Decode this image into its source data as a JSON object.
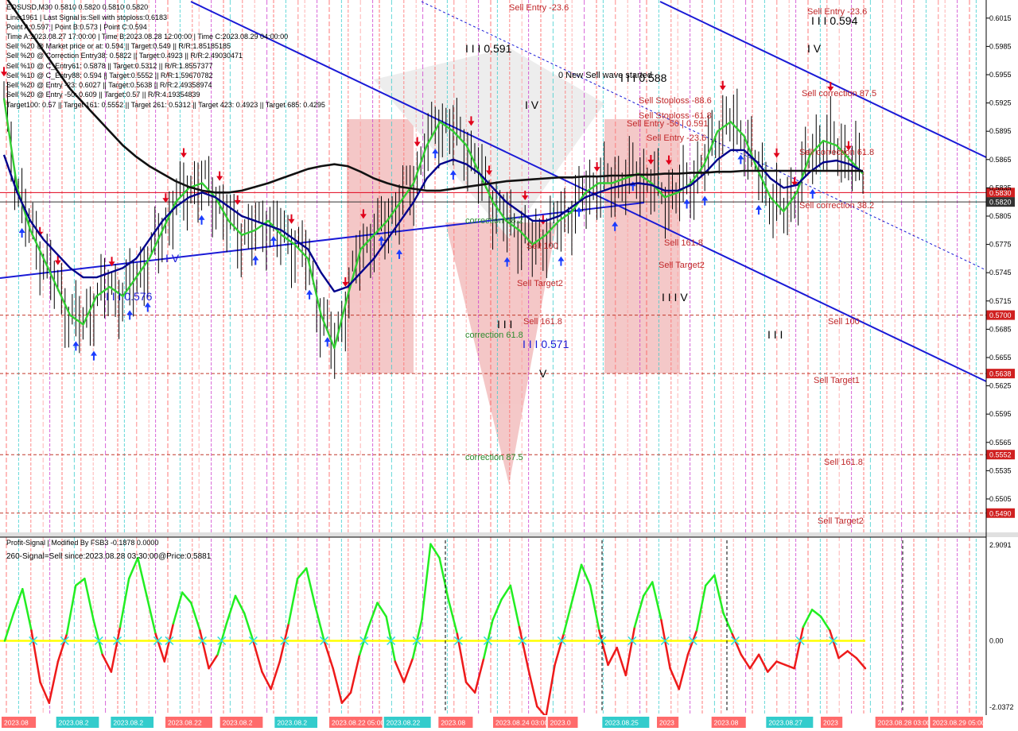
{
  "window": {
    "symbol_line": "EOSUSD,M30  0.5810 0.5820 0.5810 0.5820",
    "info_lines": [
      "Line:1961 | Last Signal is:Sell with stoploss:0.6183",
      "Point A:0.597 | Point B:0.573 | Point C:0.594",
      "Time A:2023.08.27 17:00:00 | Time B:2023.08.28 12:00:00 | Time C:2023.08.29 04:00:00",
      "Sell %20 @ Market price or at: 0.594 || Target:0.549 || R/R:1.85185185",
      "Sell %20 @ Correction Entry38: 0.5822 || Target:0.4923 || R/R:2.49030471",
      "Sell %10 @ C_Entry61: 0.5878 || Target:0.5312 || R/R:1.8557377",
      "Sell %10 @ C_Entry88: 0.594 || Target:0.5552 || R/R:1.59670782",
      "Sell %20 @ Entry -23: 0.6027 || Target:0.5638 || R/R:2.49358974",
      "Sell %20 @ Entry -50: 0.609 || Target:0.57 || R/R:4.19354839",
      "Target100: 0.57 || Target 161: 0.5552 || Target 261: 0.5312 || Target 423: 0.4923 || Target 685: 0.4295"
    ]
  },
  "colors": {
    "background": "#ffffff",
    "price_green_ma": "#32cd32",
    "price_blue_ma": "#00008b",
    "price_black_ma": "#111111",
    "channel": "#1a1ad6",
    "sell_red": "#e0001a",
    "buy_blue": "#1a3cff",
    "level_red": "#c0392b",
    "osc_green": "#22ee22",
    "osc_red": "#ee1a1a",
    "osc_zero": "#ffff00",
    "watermark": "#e8c8c8",
    "label_green": "#2e8b2e",
    "label_red": "#c0282a"
  },
  "chart_data": [
    {
      "type": "line",
      "title": "EOSUSD,M30",
      "ylim": [
        0.5478,
        0.603
      ],
      "price_ticks": [
        "0.6015",
        "0.5985",
        "0.5955",
        "0.5925",
        "0.5895",
        "0.5865",
        "0.5835",
        "0.5805",
        "0.5775",
        "0.5745",
        "0.5715",
        "0.5685",
        "0.5655",
        "0.5625",
        "0.5595",
        "0.5565",
        "0.5535",
        "0.5505"
      ],
      "price_ticks_values": [
        0.6015,
        0.5985,
        0.5955,
        0.5925,
        0.5895,
        0.5865,
        0.5835,
        0.5805,
        0.5775,
        0.5745,
        0.5715,
        0.5685,
        0.5655,
        0.5625,
        0.5595,
        0.5565,
        0.5535,
        0.5505
      ],
      "levels": [
        {
          "value": 0.583,
          "label": "0.5830",
          "style": "solid",
          "color": "#e0001a"
        },
        {
          "value": 0.582,
          "label": "0.5820",
          "style": "solid",
          "color": "#333333"
        },
        {
          "value": 0.57,
          "label": "0.5700",
          "style": "dashed",
          "color": "#c0392b"
        },
        {
          "value": 0.5638,
          "label": "0.5638",
          "style": "dashed",
          "color": "#c0392b"
        },
        {
          "value": 0.5552,
          "label": "0.5552",
          "style": "dashed",
          "color": "#c0392b"
        },
        {
          "value": 0.549,
          "label": "0.5490",
          "style": "dashed",
          "color": "#c0392b"
        }
      ],
      "annotations": [
        {
          "text": "Sell Entry -23.6",
          "color": "red"
        },
        {
          "text": "Sell Entry -23.6",
          "color": "red"
        },
        {
          "text": "I I I 0.591",
          "color": "black"
        },
        {
          "text": "I I I 0.594",
          "color": "black"
        },
        {
          "text": "0 New Sell wave started",
          "color": "black"
        },
        {
          "text": "I I I 0.588",
          "color": "black"
        },
        {
          "text": "I V",
          "color": "black"
        },
        {
          "text": "I V",
          "color": "black"
        },
        {
          "text": "Sell correction 87.5",
          "color": "red"
        },
        {
          "text": "Sell Stoploss -88.6",
          "color": "red"
        },
        {
          "text": "Sell Stoploss -61.8",
          "color": "red"
        },
        {
          "text": "Sell Entry -50 | 0.591",
          "color": "red"
        },
        {
          "text": "Sell Entry -23.6",
          "color": "red"
        },
        {
          "text": "Sell correction 61.8",
          "color": "red"
        },
        {
          "text": "Sell correction 38.2",
          "color": "red"
        },
        {
          "text": "correction 38.2",
          "color": "green"
        },
        {
          "text": "Sell 100",
          "color": "red"
        },
        {
          "text": "Sell 161.8",
          "color": "red"
        },
        {
          "text": "Sell Target2",
          "color": "red"
        },
        {
          "text": "I V",
          "color": "blue"
        },
        {
          "text": "I I I 0.576",
          "color": "blue"
        },
        {
          "text": "Sell Target2",
          "color": "red"
        },
        {
          "text": "I I I V",
          "color": "black"
        },
        {
          "text": "I I I",
          "color": "black"
        },
        {
          "text": "Sell 161.8",
          "color": "red"
        },
        {
          "text": "correction 61.8",
          "color": "green"
        },
        {
          "text": "I I I 0.571",
          "color": "blue"
        },
        {
          "text": "V",
          "color": "black"
        },
        {
          "text": "Sell 100",
          "color": "red"
        },
        {
          "text": "I I I",
          "color": "black"
        },
        {
          "text": "Sell Target1",
          "color": "red"
        },
        {
          "text": "correction 87.5",
          "color": "green"
        },
        {
          "text": "Sell 161.8",
          "color": "red"
        },
        {
          "text": "Sell Target2",
          "color": "red"
        }
      ],
      "watermark_text": "MARKETZISITE",
      "series": [
        {
          "name": "",
          "values": [
            0.593,
            0.5835,
            0.579,
            0.576,
            0.573,
            0.57,
            0.569,
            0.572,
            0.573,
            0.572,
            0.574,
            0.576,
            0.579,
            0.582,
            0.5835,
            0.584,
            0.5825,
            0.58,
            0.5785,
            0.579,
            0.58,
            0.5785,
            0.5775,
            0.576,
            0.57,
            0.5665,
            0.572,
            0.577,
            0.5785,
            0.58,
            0.582,
            0.584,
            0.588,
            0.5905,
            0.5895,
            0.588,
            0.585,
            0.582,
            0.58,
            0.579,
            0.5775,
            0.5785,
            0.58,
            0.581,
            0.583,
            0.584,
            0.584,
            0.5845,
            0.585,
            0.584,
            0.5825,
            0.583,
            0.584,
            0.586,
            0.5895,
            0.5905,
            0.589,
            0.5855,
            0.5825,
            0.581,
            0.583,
            0.587,
            0.5885,
            0.588,
            0.5865,
            0.585
          ]
        },
        {
          "name": "",
          "values": [
            0.587,
            0.583,
            0.58,
            0.578,
            0.5765,
            0.575,
            0.574,
            0.574,
            0.5745,
            0.575,
            0.576,
            0.578,
            0.58,
            0.5815,
            0.5825,
            0.583,
            0.5825,
            0.5815,
            0.5805,
            0.58,
            0.5795,
            0.579,
            0.578,
            0.577,
            0.5745,
            0.5725,
            0.573,
            0.5745,
            0.576,
            0.578,
            0.58,
            0.582,
            0.5845,
            0.586,
            0.5865,
            0.586,
            0.585,
            0.5835,
            0.582,
            0.581,
            0.58,
            0.58,
            0.5805,
            0.5815,
            0.5825,
            0.583,
            0.5835,
            0.5838,
            0.584,
            0.5838,
            0.5832,
            0.5832,
            0.5838,
            0.585,
            0.5865,
            0.5875,
            0.5875,
            0.5862,
            0.5845,
            0.5835,
            0.5838,
            0.5852,
            0.5862,
            0.5864,
            0.586,
            0.5852
          ]
        },
        {
          "name": "",
          "values": [
            0.604,
            0.602,
            0.6,
            0.598,
            0.596,
            0.594,
            0.5925,
            0.591,
            0.5895,
            0.588,
            0.5868,
            0.5858,
            0.585,
            0.5842,
            0.5836,
            0.5832,
            0.583,
            0.583,
            0.5832,
            0.5836,
            0.584,
            0.5845,
            0.585,
            0.5855,
            0.5858,
            0.586,
            0.5858,
            0.5852,
            0.5845,
            0.584,
            0.5836,
            0.5834,
            0.5832,
            0.5832,
            0.5834,
            0.5836,
            0.5838,
            0.584,
            0.5842,
            0.5843,
            0.5844,
            0.5845,
            0.5846,
            0.5846,
            0.5847,
            0.5847,
            0.5848,
            0.5848,
            0.5849,
            0.5849,
            0.585,
            0.585,
            0.5851,
            0.5851,
            0.5852,
            0.5852,
            0.5853,
            0.5853,
            0.5853,
            0.5853,
            0.5853,
            0.5853,
            0.5853,
            0.5853,
            0.5853,
            0.5853
          ]
        }
      ]
    },
    {
      "type": "line",
      "title": "Profit-Signal | Modified By FSB3 -0.1878 0.0000",
      "subtitle": "260-Signal=Sell since:2023.08.28 03:30:00@Price:0.5881",
      "ylim": [
        -2.0372,
        2.9091
      ],
      "ticks": [
        "2.9091",
        "0.00",
        "-2.0372"
      ],
      "ticks_values": [
        2.9091,
        0.0,
        -2.0372
      ],
      "series": [
        {
          "name": "",
          "values": [
            0.0,
            0.8,
            1.5,
            0.3,
            -1.2,
            -1.8,
            -0.6,
            0.2,
            1.6,
            1.8,
            0.6,
            -0.4,
            -0.9,
            0.4,
            1.8,
            2.4,
            1.3,
            0.2,
            -0.6,
            0.5,
            1.4,
            1.1,
            0.3,
            -0.8,
            -0.4,
            0.5,
            1.3,
            0.8,
            0.0,
            -0.9,
            -1.4,
            -0.6,
            0.5,
            1.8,
            2.1,
            1.0,
            0.0,
            -0.8,
            -1.8,
            -1.5,
            -0.4,
            0.4,
            1.1,
            0.7,
            -0.6,
            -1.2,
            -0.5,
            0.6,
            2.8,
            2.4,
            1.2,
            0.2,
            -1.2,
            -1.5,
            -0.5,
            0.6,
            1.2,
            1.6,
            0.4,
            -0.8,
            -1.9,
            -2.2,
            -0.7,
            0.2,
            1.2,
            2.2,
            1.6,
            0.3,
            -0.7,
            -0.2,
            -1.0,
            0.4,
            1.3,
            1.7,
            0.6,
            -0.8,
            -1.4,
            -0.4,
            0.3,
            1.6,
            1.9,
            0.8,
            0.2,
            -0.4,
            -0.8,
            -0.4,
            -0.9,
            -0.6,
            -0.7,
            -0.8,
            0.4,
            0.9,
            0.7,
            0.3,
            -0.5,
            -0.3,
            -0.5,
            -0.8
          ]
        }
      ]
    }
  ],
  "time_axis": {
    "labels": [
      "2023.08",
      "2023.08.2",
      "2023.08.2",
      "2023.08.22",
      "2023.08.2",
      "2023.08.2",
      "2023.08.22 05:00",
      "2023.08.22",
      "2023.08",
      "2023.08.24 03:00",
      "2023.0",
      "2023.08.25",
      "2023",
      "2023.08",
      "2023.08.27",
      "2023",
      "2023.08.28 03:00",
      "2023.08.29 05:00"
    ]
  }
}
